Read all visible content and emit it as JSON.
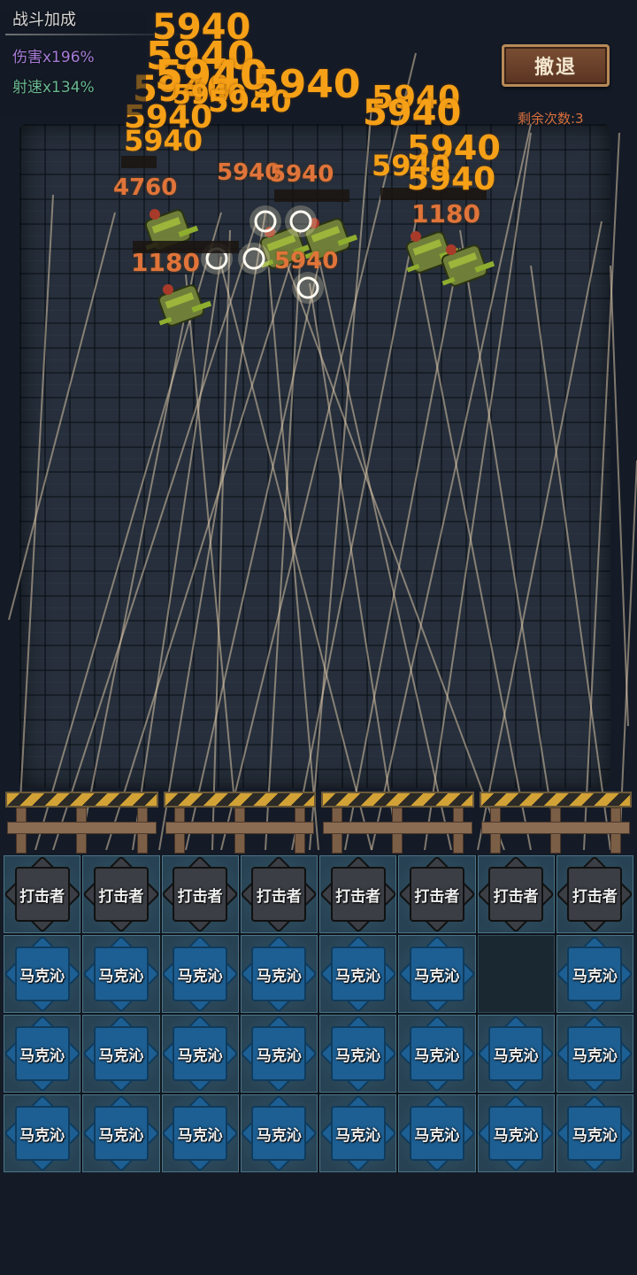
{
  "hud": {
    "buff_title": "战斗加成",
    "damage_buff": "伤害x196%",
    "firerate_buff": "射速x134%",
    "retreat_label": "撤退",
    "remaining": "剩余次数:3"
  },
  "damage_numbers": [
    "5940",
    "5940",
    "5940",
    "5940",
    "5940",
    "5940",
    "5940",
    "5940",
    "5940",
    "5940",
    "5940",
    "5940",
    "5940",
    "5940",
    "5940",
    "5940",
    "5940",
    "4760",
    "1180",
    "1180"
  ],
  "grid": {
    "rows": [
      [
        "打击者",
        "打击者",
        "打击者",
        "打击者",
        "打击者",
        "打击者",
        "打击者",
        "打击者"
      ],
      [
        "马克沁",
        "马克沁",
        "马克沁",
        "马克沁",
        "马克沁",
        "马克沁",
        "",
        "马克沁"
      ],
      [
        "马克沁",
        "马克沁",
        "马克沁",
        "马克沁",
        "马克沁",
        "马克沁",
        "马克沁",
        "马克沁"
      ],
      [
        "马克沁",
        "马克沁",
        "马克沁",
        "马克沁",
        "马克沁",
        "马克沁",
        "马克沁",
        "马克沁"
      ]
    ]
  },
  "colors": {
    "damage_text": "#f5a017",
    "damage_buff": "#a77cd9",
    "firerate_buff": "#69b892",
    "remaining": "#d96f3b"
  },
  "icons": {
    "zombie": "zombie-enemy-icon",
    "striker": "striker-unit-icon",
    "marksman": "maxim-gun-unit-icon"
  }
}
